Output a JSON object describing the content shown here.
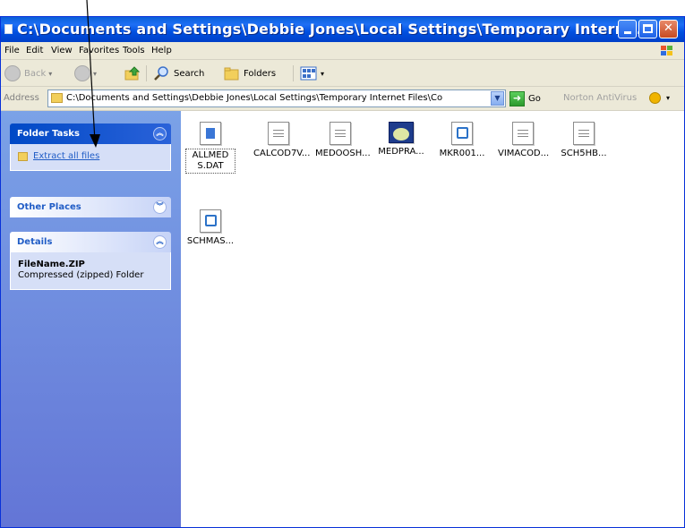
{
  "window": {
    "title": "C:\\Documents and Settings\\Debbie Jones\\Local Settings\\Temporary Intern...",
    "controls": {
      "minimize": "",
      "maximize": "",
      "close": "✕"
    }
  },
  "menu": [
    "File",
    "Edit",
    "View",
    "Favorites",
    "Tools",
    "Help"
  ],
  "toolbar": {
    "back_label": "Back",
    "search_label": "Search",
    "folders_label": "Folders"
  },
  "address": {
    "label": "Address",
    "value": "C:\\Documents and Settings\\Debbie Jones\\Local Settings\\Temporary Internet Files\\Co",
    "go_label": "Go",
    "norton_label": "Norton AntiVirus"
  },
  "sidebar": {
    "folder_tasks": {
      "title": "Folder Tasks",
      "link": "Extract all files"
    },
    "other_places": {
      "title": "Other Places"
    },
    "details": {
      "title": "Details",
      "name": "FileName.ZIP",
      "type": "Compressed (zipped) Folder"
    }
  },
  "files": [
    {
      "name": "ALLMEDS.DAT",
      "icon": "bat-file-icon",
      "selected": true
    },
    {
      "name": "CALCOD7V...",
      "icon": "text-file-icon"
    },
    {
      "name": "MEDOOSH...",
      "icon": "text-file-icon"
    },
    {
      "name": "MEDPRA...",
      "icon": "exe-file-icon"
    },
    {
      "name": "MKR001...",
      "icon": "doc-file-icon"
    },
    {
      "name": "VIMACOD...",
      "icon": "text-file-icon"
    },
    {
      "name": "SCH5HB...",
      "icon": "text-file-icon"
    },
    {
      "name": "SCHMAS...",
      "icon": "doc-file-icon"
    }
  ],
  "colors": {
    "titlebar": "#0a5fd8",
    "sidebar": "#7ba2e7",
    "link": "#215dc6"
  }
}
